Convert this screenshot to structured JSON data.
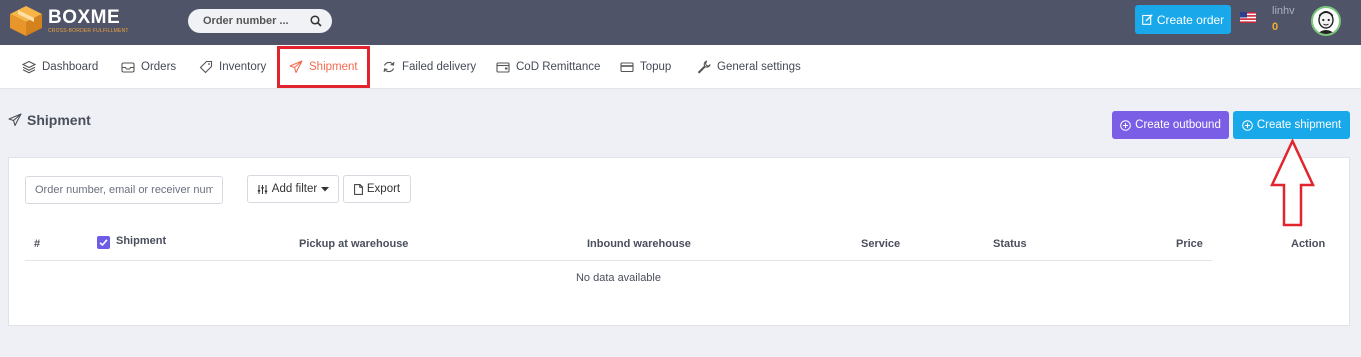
{
  "header": {
    "logo": {
      "name": "BOXME",
      "tagline": "CROSS-BORDER FULFILLMENT"
    },
    "search": {
      "placeholder": "Order number ..."
    },
    "create_order_label": "Create order",
    "user": {
      "name": "linhv",
      "balance": "0"
    }
  },
  "nav": {
    "items": [
      {
        "label": "Dashboard",
        "icon": "layers-icon"
      },
      {
        "label": "Orders",
        "icon": "inbox-icon"
      },
      {
        "label": "Inventory",
        "icon": "tag-icon"
      },
      {
        "label": "Shipment",
        "icon": "plane-icon",
        "active": true
      },
      {
        "label": "Failed delivery",
        "icon": "refresh-icon"
      },
      {
        "label": "CoD Remittance",
        "icon": "wallet-icon"
      },
      {
        "label": "Topup",
        "icon": "credit-card-icon"
      },
      {
        "label": "General settings",
        "icon": "wrench-icon"
      }
    ]
  },
  "page": {
    "title": "Shipment",
    "create_outbound_label": "Create outbound",
    "create_shipment_label": "Create shipment"
  },
  "filters": {
    "search_placeholder": "Order number, email or receiver number",
    "add_filter_label": "Add filter",
    "export_label": "Export"
  },
  "table": {
    "columns": [
      "#",
      "Shipment",
      "Pickup at warehouse",
      "Inbound warehouse",
      "Service",
      "Status",
      "Price",
      "Action"
    ],
    "empty_text": "No data available"
  },
  "colors": {
    "topbar": "#4f5468",
    "accent_blue": "#19a8ea",
    "accent_purple": "#7b5ee6",
    "active_nav": "#f26a50",
    "annotation_red": "#e1242d"
  }
}
